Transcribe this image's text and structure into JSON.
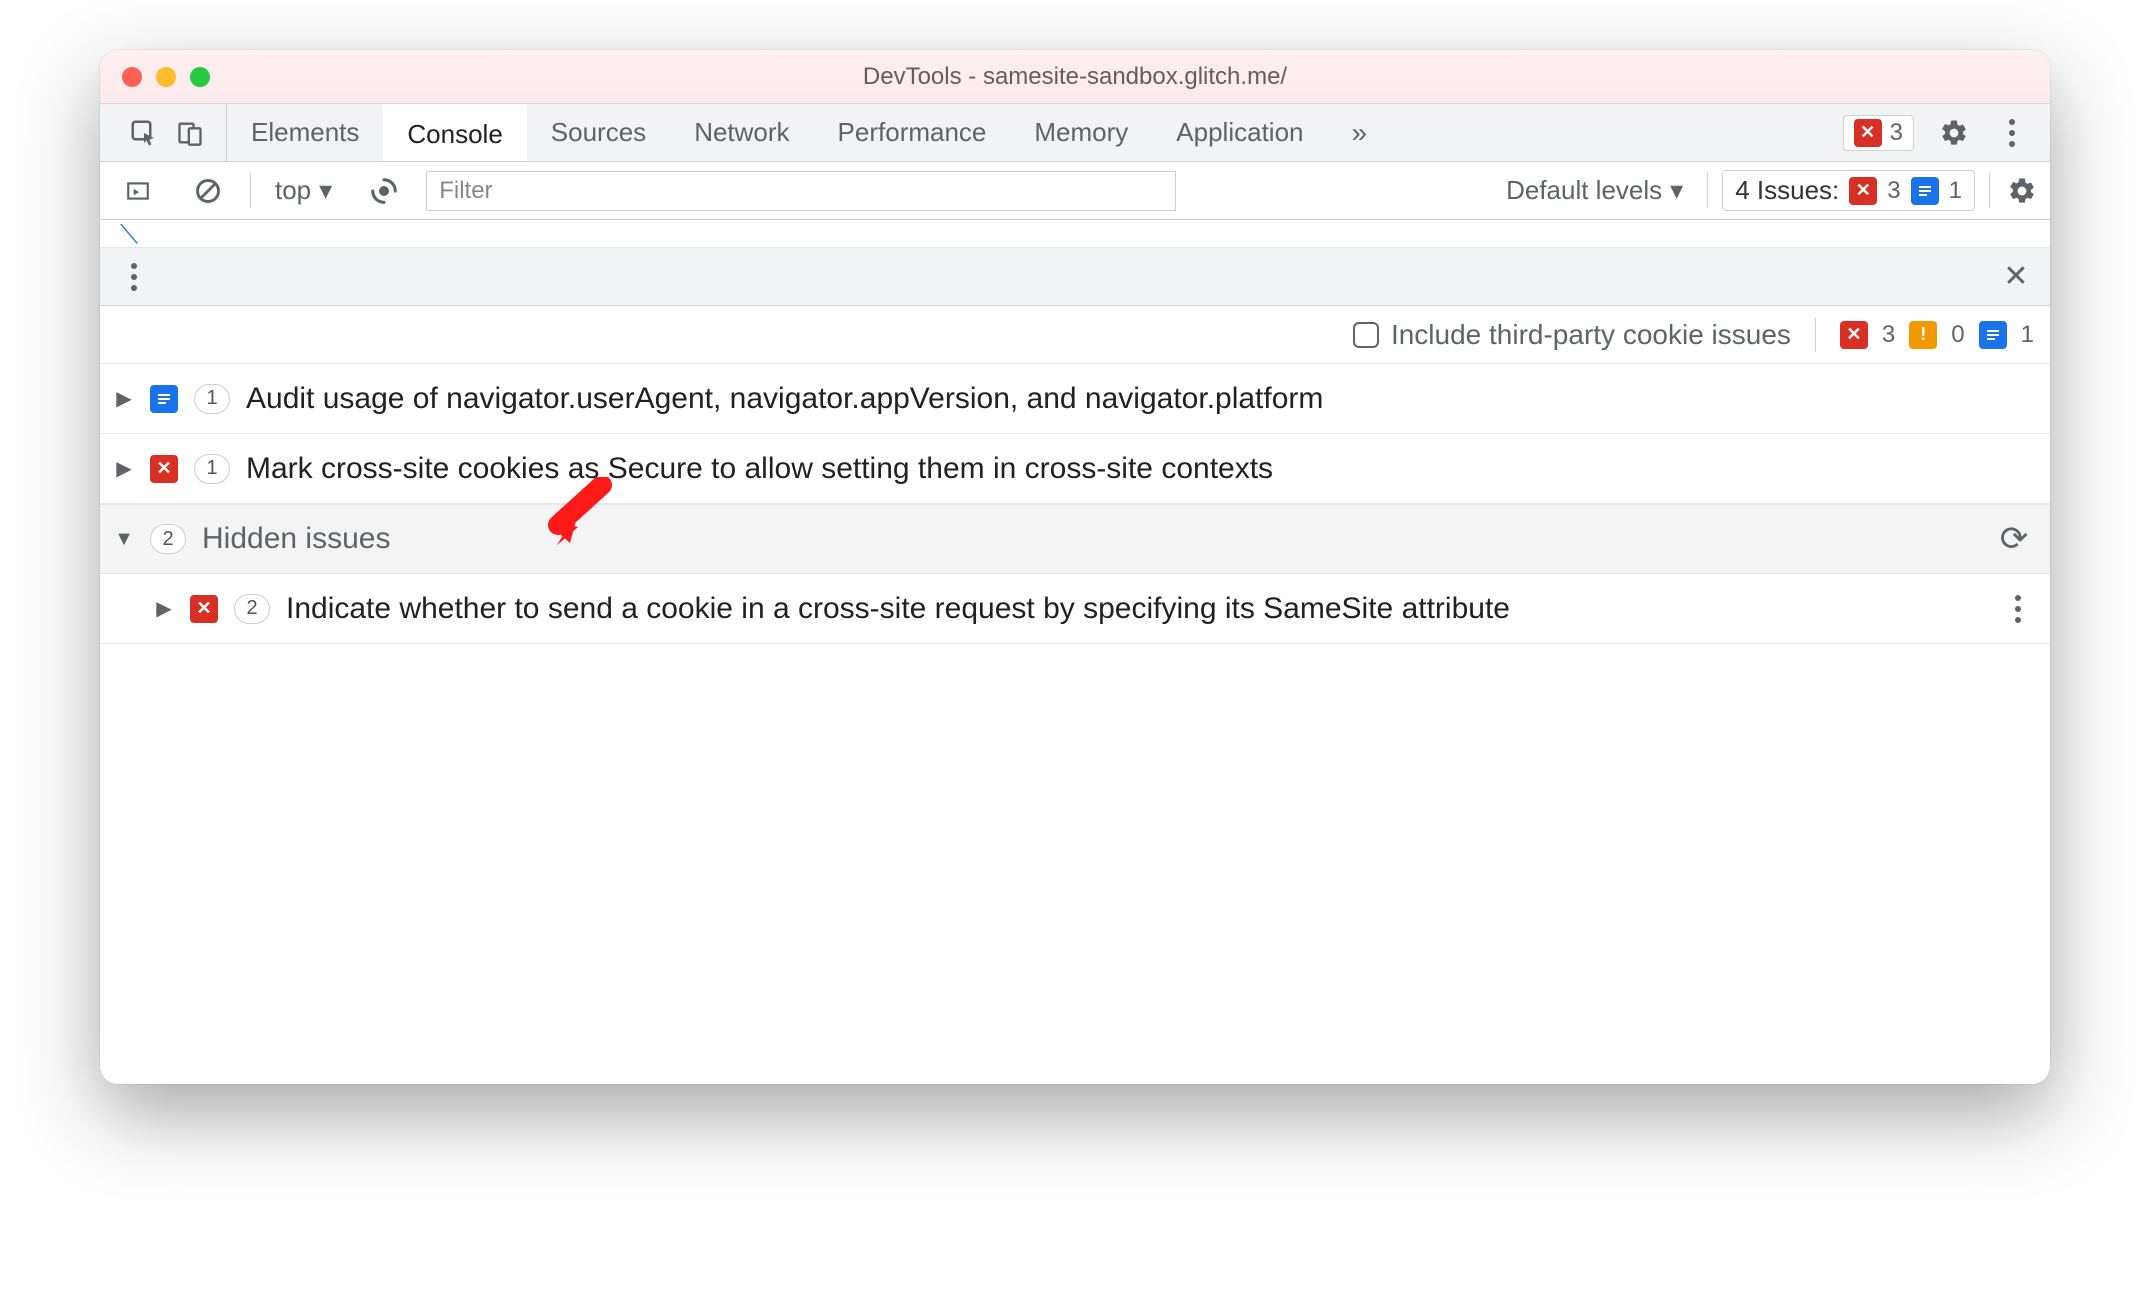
{
  "window": {
    "title": "DevTools - samesite-sandbox.glitch.me/"
  },
  "tabs": {
    "items": [
      "Elements",
      "Console",
      "Sources",
      "Network",
      "Performance",
      "Memory",
      "Application"
    ],
    "active_index": 1,
    "overflow_glyph": "»"
  },
  "tabstrip_right": {
    "error_count": "3"
  },
  "filterbar": {
    "context": "top",
    "filter_placeholder": "Filter",
    "levels_label": "Default levels",
    "issues_label": "4 Issues:",
    "issues_error": "3",
    "issues_info": "1"
  },
  "optionsrow": {
    "checkbox_label": "Include third-party cookie issues",
    "counts": {
      "error": "3",
      "warn": "0",
      "info": "1"
    }
  },
  "issues": [
    {
      "icon": "info",
      "count": "1",
      "text": "Audit usage of navigator.userAgent, navigator.appVersion, and navigator.platform"
    },
    {
      "icon": "error",
      "count": "1",
      "text": "Mark cross-site cookies as Secure to allow setting them in cross-site contexts"
    }
  ],
  "hidden": {
    "count": "2",
    "label": "Hidden issues",
    "items": [
      {
        "icon": "error",
        "count": "2",
        "text": "Indicate whether to send a cookie in a cross-site request by specifying its SameSite attribute"
      }
    ]
  },
  "glyphs": {
    "tri_right": "▶",
    "tri_down": "▼",
    "caret_down": "▾",
    "close_x": "✕",
    "x_white": "✕",
    "bang": "!",
    "reload": "⟳"
  }
}
